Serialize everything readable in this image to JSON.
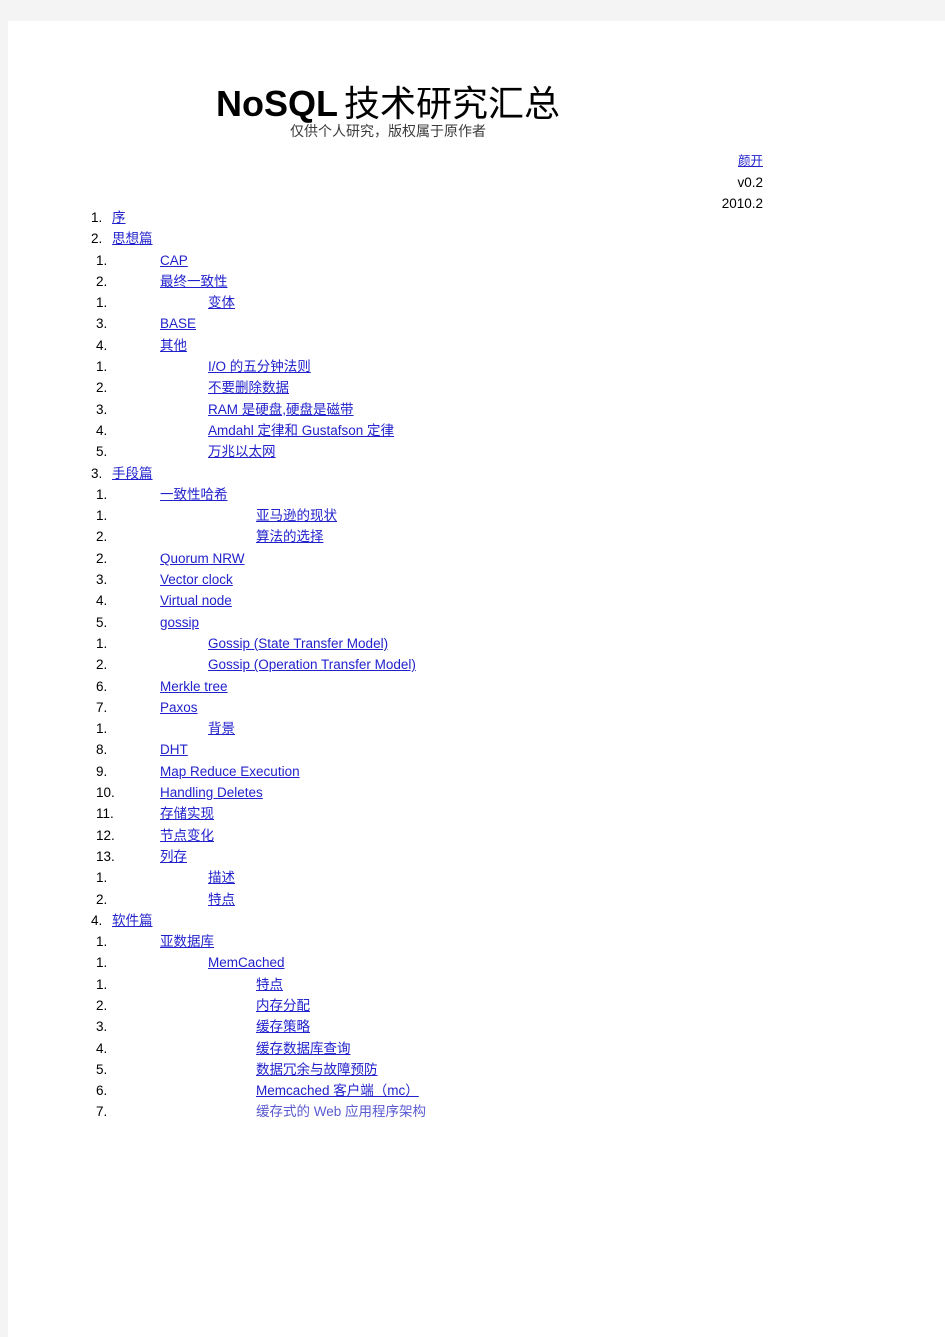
{
  "header": {
    "title_latin": "NoSQL",
    "title_cjk": "技术研究汇总",
    "subtitle": "仅供个人研究，版权属于原作者",
    "author": "颜开",
    "version": "v0.2",
    "date": "2010.2"
  },
  "toc": [
    {
      "num": "1.",
      "level": 1,
      "text": "序",
      "link": true
    },
    {
      "num": "2.",
      "level": 1,
      "text": "思想篇",
      "link": true
    },
    {
      "num": "1.",
      "level": 2,
      "text": "CAP",
      "link": true
    },
    {
      "num": "2.",
      "level": 2,
      "text": "最终一致性",
      "link": true
    },
    {
      "num": "1.",
      "level": 3,
      "text": "变体",
      "link": true
    },
    {
      "num": "3.",
      "level": 2,
      "text": "BASE",
      "link": true
    },
    {
      "num": "4.",
      "level": 2,
      "text": "其他",
      "link": true
    },
    {
      "num": "1.",
      "level": 3,
      "text": "I/O 的五分钟法则",
      "link": true
    },
    {
      "num": "2.",
      "level": 3,
      "text": "不要删除数据",
      "link": true
    },
    {
      "num": "3.",
      "level": 3,
      "text": "RAM 是硬盘,硬盘是磁带",
      "link": true
    },
    {
      "num": "4.",
      "level": 3,
      "text": "Amdahl 定律和 Gustafson 定律",
      "link": true
    },
    {
      "num": "5.",
      "level": 3,
      "text": "万兆以太网",
      "link": true
    },
    {
      "num": "3.",
      "level": 1,
      "text": "手段篇",
      "link": true
    },
    {
      "num": "1.",
      "level": 2,
      "text": "一致性哈希",
      "link": true
    },
    {
      "num": "1.",
      "level": 4,
      "text": "亚马逊的现状",
      "link": true
    },
    {
      "num": "2.",
      "level": 4,
      "text": "算法的选择",
      "link": true
    },
    {
      "num": "2.",
      "level": 2,
      "text": "Quorum NRW",
      "link": true
    },
    {
      "num": "3.",
      "level": 2,
      "text": "Vector clock",
      "link": true
    },
    {
      "num": "4.",
      "level": 2,
      "text": "Virtual node",
      "link": true
    },
    {
      "num": "5.",
      "level": 2,
      "text": "gossip",
      "link": true
    },
    {
      "num": "1.",
      "level": 3,
      "text": "Gossip (State Transfer Model)",
      "link": true
    },
    {
      "num": "2.",
      "level": 3,
      "text": "Gossip (Operation Transfer Model)",
      "link": true
    },
    {
      "num": "6.",
      "level": 2,
      "text": "Merkle tree",
      "link": true
    },
    {
      "num": "7.",
      "level": 2,
      "text": "Paxos",
      "link": true
    },
    {
      "num": "1.",
      "level": 3,
      "text": "背景",
      "link": true
    },
    {
      "num": "8.",
      "level": 2,
      "text": "DHT",
      "link": true
    },
    {
      "num": "9.",
      "level": 2,
      "text": "Map Reduce Execution",
      "link": true
    },
    {
      "num": "10.",
      "level": 2,
      "text": "Handling Deletes",
      "link": true
    },
    {
      "num": "11.",
      "level": 2,
      "text": "存储实现",
      "link": true
    },
    {
      "num": "12.",
      "level": 2,
      "text": "节点变化",
      "link": true
    },
    {
      "num": "13.",
      "level": 2,
      "text": "列存",
      "link": true
    },
    {
      "num": "1.",
      "level": 3,
      "text": "描述",
      "link": true
    },
    {
      "num": "2.",
      "level": 3,
      "text": "特点",
      "link": true
    },
    {
      "num": "4.",
      "level": 1,
      "text": "软件篇",
      "link": true
    },
    {
      "num": "1.",
      "level": 2,
      "text": "亚数据库",
      "link": true
    },
    {
      "num": "1.",
      "level": 3,
      "text": "MemCached",
      "link": true
    },
    {
      "num": "1.",
      "level": 4,
      "text": "特点",
      "link": true
    },
    {
      "num": "2.",
      "level": 4,
      "text": "内存分配",
      "link": true
    },
    {
      "num": "3.",
      "level": 4,
      "text": "缓存策略",
      "link": true
    },
    {
      "num": "4.",
      "level": 4,
      "text": "缓存数据库查询",
      "link": true
    },
    {
      "num": "5.",
      "level": 4,
      "text": "数据冗余与故障预防",
      "link": true
    },
    {
      "num": "6.",
      "level": 4,
      "text": "Memcached 客户端（mc）",
      "link": true
    },
    {
      "num": "7.",
      "level": 4,
      "text": "缓存式的 Web 应用程序架构",
      "link": false
    }
  ]
}
